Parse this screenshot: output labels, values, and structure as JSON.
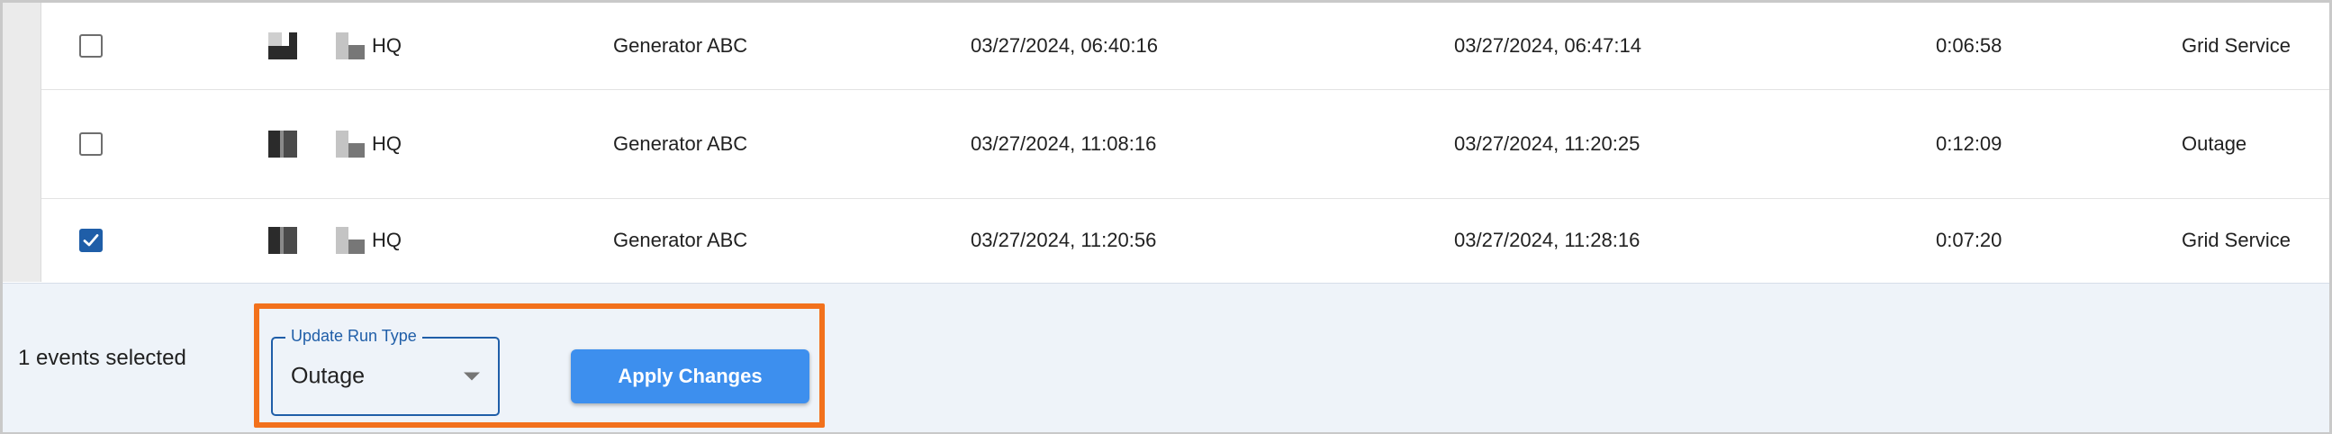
{
  "rows": [
    {
      "checked": false,
      "site": "HQ",
      "generator": "Generator ABC",
      "start": "03/27/2024, 06:40:16",
      "end": "03/27/2024, 06:47:14",
      "duration": "0:06:58",
      "run_type": "Grid Service"
    },
    {
      "checked": false,
      "site": "HQ",
      "generator": "Generator ABC",
      "start": "03/27/2024, 11:08:16",
      "end": "03/27/2024, 11:20:25",
      "duration": "0:12:09",
      "run_type": "Outage"
    },
    {
      "checked": true,
      "site": "HQ",
      "generator": "Generator ABC",
      "start": "03/27/2024, 11:20:56",
      "end": "03/27/2024, 11:28:16",
      "duration": "0:07:20",
      "run_type": "Grid Service"
    }
  ],
  "footer": {
    "selected_count_text": "1 events selected",
    "run_type_field": {
      "label": "Update Run Type",
      "value": "Outage"
    },
    "apply_label": "Apply Changes"
  },
  "colors": {
    "accent": "#3d8fee",
    "checkbox_checked": "#1f5ea8",
    "highlight": "#f2711c",
    "footer_bg": "#eef3f9"
  },
  "icons": {
    "device": "device-status-icon",
    "site": "building-icon",
    "caret": "chevron-down-icon",
    "check": "check-icon"
  }
}
